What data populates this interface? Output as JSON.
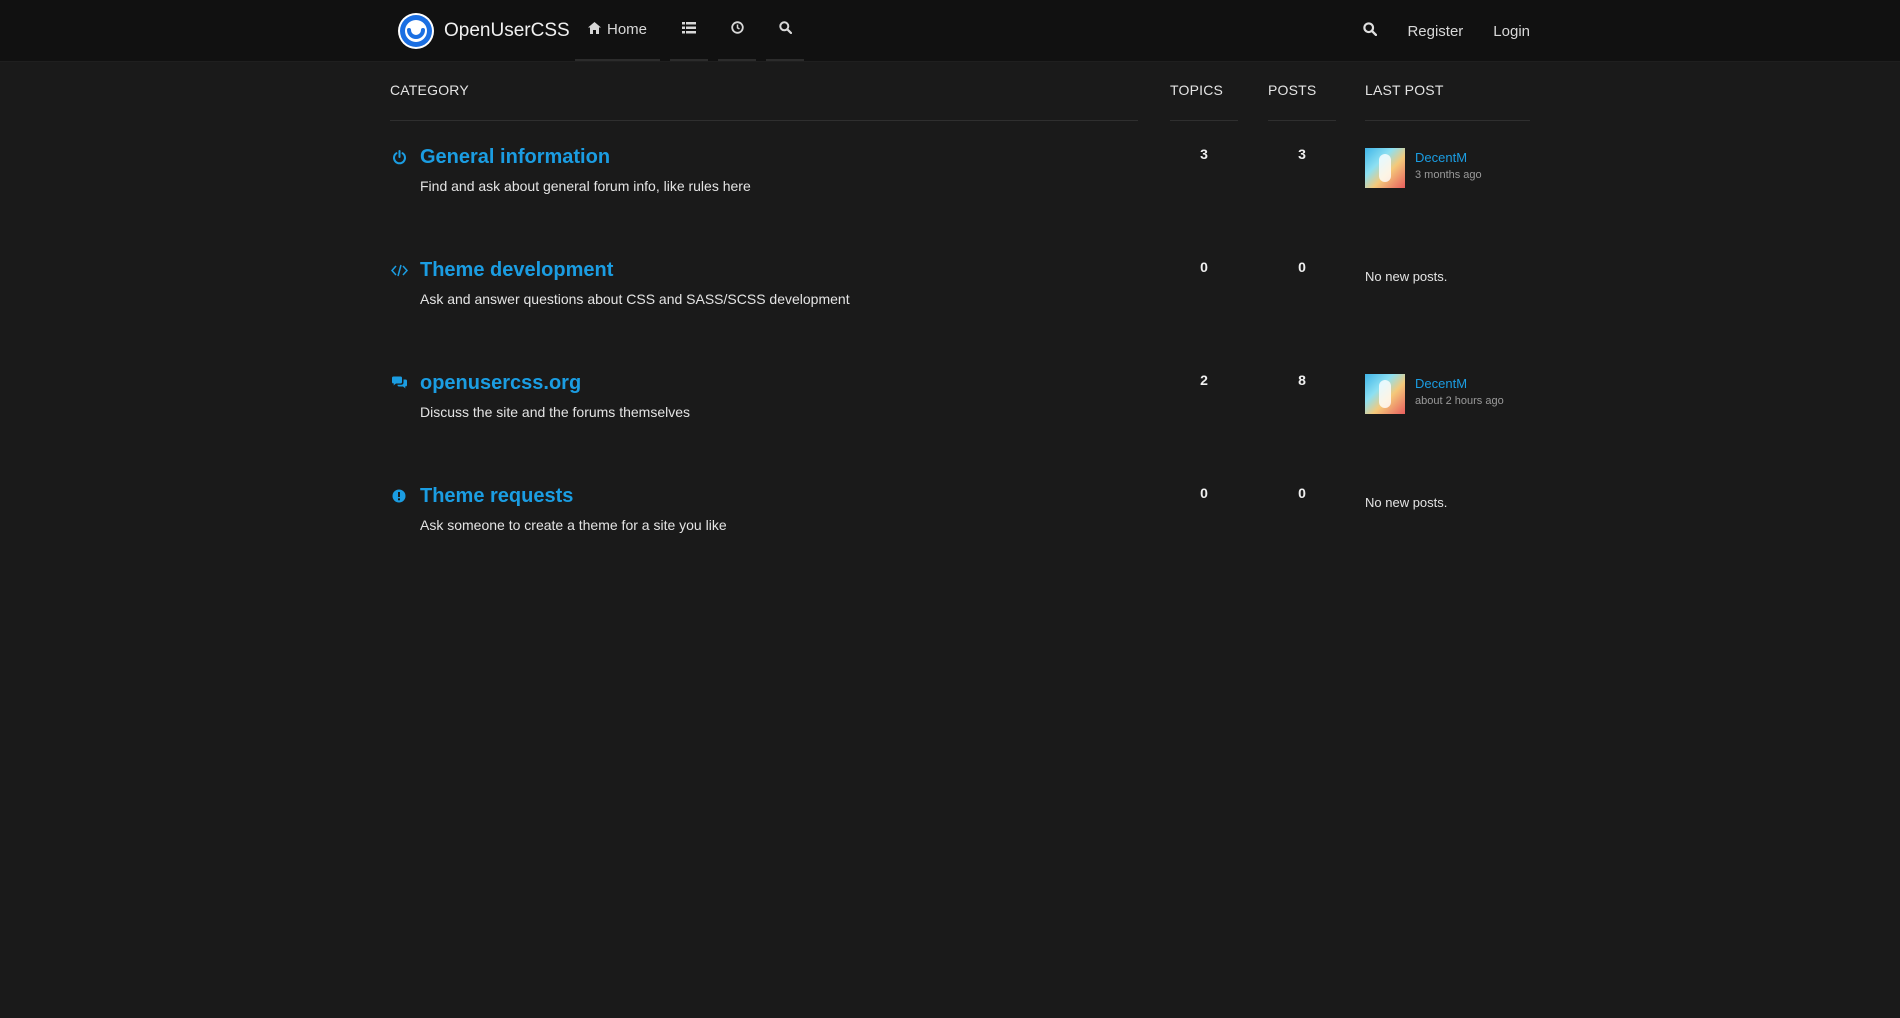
{
  "brand": {
    "title": "OpenUserCSS",
    "logo_icon": "openusercss-logo-icon"
  },
  "nav": {
    "home_label": "Home",
    "items": [
      {
        "icon": "home-icon",
        "label": "Home"
      },
      {
        "icon": "list-icon"
      },
      {
        "icon": "clock-icon"
      },
      {
        "icon": "search-icon"
      }
    ]
  },
  "right_nav": {
    "search_icon": "search-icon",
    "register_label": "Register",
    "login_label": "Login"
  },
  "table": {
    "headers": {
      "category": "CATEGORY",
      "topics": "TOPICS",
      "posts": "POSTS",
      "last_post": "LAST POST"
    },
    "rows": [
      {
        "icon": "power-icon",
        "title": "General information",
        "description": "Find and ask about general forum info, like rules here",
        "topics": "3",
        "posts": "3",
        "last_user": "DecentM",
        "last_time": "3 months ago"
      },
      {
        "icon": "code-icon",
        "title": "Theme development",
        "description": "Ask and answer questions about CSS and SASS/SCSS development",
        "topics": "0",
        "posts": "0",
        "no_posts": "No new posts."
      },
      {
        "icon": "comments-icon",
        "title": "openusercss.org",
        "description": "Discuss the site and the forums themselves",
        "topics": "2",
        "posts": "8",
        "last_user": "DecentM",
        "last_time": "about 2 hours ago"
      },
      {
        "icon": "exclamation-icon",
        "title": "Theme requests",
        "description": "Ask someone to create a theme for a site you like",
        "topics": "0",
        "posts": "0",
        "no_posts": "No new posts."
      }
    ]
  },
  "colors": {
    "accent": "#1b9de2",
    "background": "#1a1a1a",
    "topbar": "#111111"
  }
}
